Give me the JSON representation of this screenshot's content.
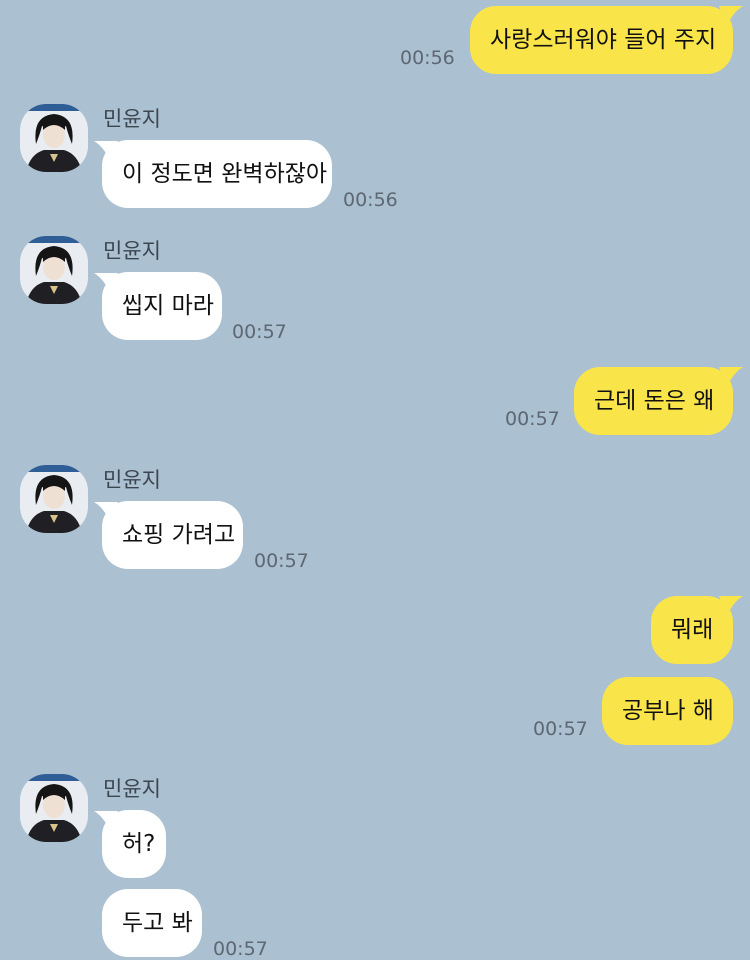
{
  "messages": [
    {
      "id": "m1",
      "side": "me",
      "text": "사랑스러워야 들어 주지",
      "time": "00:56"
    },
    {
      "id": "m2",
      "side": "them",
      "sender": "민윤지",
      "text": "이 정도면 완벽하잖아",
      "time": "00:56"
    },
    {
      "id": "m3",
      "side": "them",
      "sender": "민윤지",
      "text": "씹지 마라",
      "time": "00:57"
    },
    {
      "id": "m4",
      "side": "me",
      "text": "근데 돈은 왜",
      "time": "00:57"
    },
    {
      "id": "m5",
      "side": "them",
      "sender": "민윤지",
      "text": "쇼핑 가려고",
      "time": "00:57"
    },
    {
      "id": "m6",
      "side": "me",
      "texts": [
        "뭐래",
        "공부나 해"
      ],
      "time": "00:57"
    },
    {
      "id": "m7",
      "side": "them",
      "sender": "민윤지",
      "texts": [
        "허?",
        "두고 봐"
      ],
      "time": "00:57"
    }
  ],
  "colors": {
    "background": "#abc0d1",
    "my_bubble": "#f9e44a",
    "their_bubble": "#ffffff"
  },
  "icons": {
    "avatar": "profile-photo"
  }
}
